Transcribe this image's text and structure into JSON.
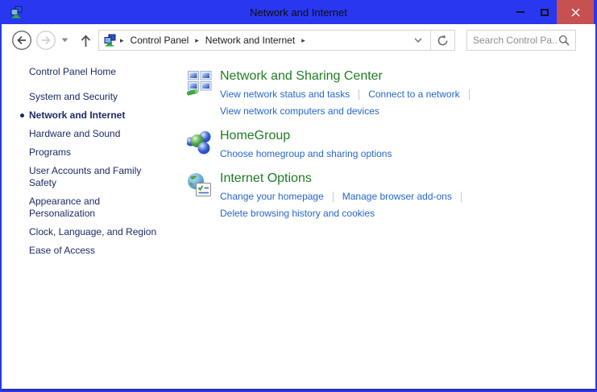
{
  "window": {
    "title": "Network and Internet"
  },
  "icons": {
    "breadcrumb_arrow": "▸"
  },
  "toolbar": {
    "breadcrumb": {
      "items": [
        "Control Panel",
        "Network and Internet"
      ]
    },
    "search": {
      "placeholder": "Search Control Pa..."
    }
  },
  "sidebar": {
    "home": "Control Panel Home",
    "active_item": "Network and Internet",
    "items": [
      "System and Security",
      "Network and Internet",
      "Hardware and Sound",
      "Programs",
      "User Accounts and Family Safety",
      "Appearance and Personalization",
      "Clock, Language, and Region",
      "Ease of Access"
    ]
  },
  "main": {
    "sections": [
      {
        "icon": "network-sharing-center-icon",
        "title": "Network and Sharing Center",
        "links": [
          [
            "View network status and tasks",
            "Connect to a network"
          ],
          [
            "View network computers and devices"
          ]
        ]
      },
      {
        "icon": "homegroup-icon",
        "title": "HomeGroup",
        "links": [
          [
            "Choose homegroup and sharing options"
          ]
        ]
      },
      {
        "icon": "internet-options-icon",
        "title": "Internet Options",
        "links": [
          [
            "Change your homepage",
            "Manage browser add-ons"
          ],
          [
            "Delete browsing history and cookies"
          ]
        ]
      }
    ]
  },
  "colors": {
    "titlebar_blue": "#2837f0",
    "close_button": "#c75050",
    "section_title_green": "#1e7d21",
    "task_link_blue": "#2467c9",
    "sidebar_navy": "#1b2a63"
  }
}
